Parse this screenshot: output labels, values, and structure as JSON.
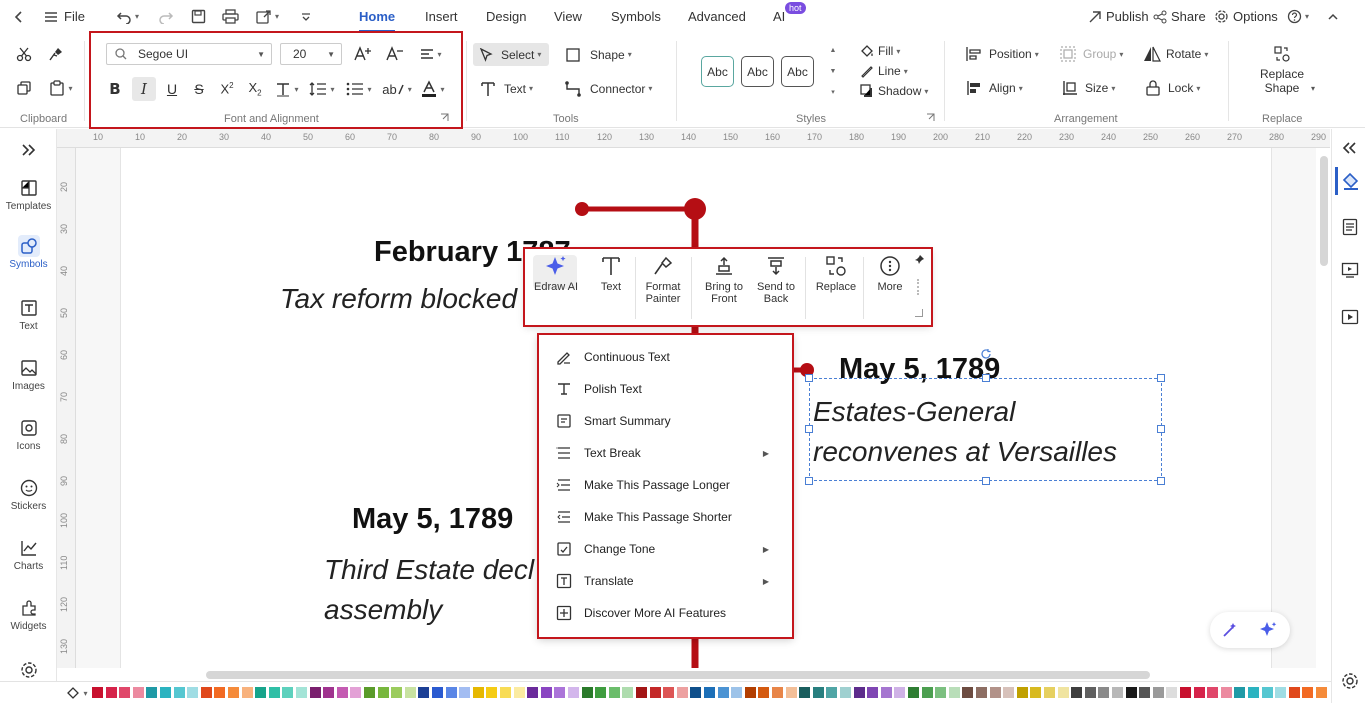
{
  "topbar": {
    "file_label": "File",
    "tabs": [
      {
        "label": "Home"
      },
      {
        "label": "Insert"
      },
      {
        "label": "Design"
      },
      {
        "label": "View"
      },
      {
        "label": "Symbols"
      },
      {
        "label": "Advanced"
      },
      {
        "label": "AI"
      }
    ],
    "hot_badge": "hot",
    "publish_label": "Publish",
    "share_label": "Share",
    "options_label": "Options"
  },
  "ribbon": {
    "groups": {
      "clipboard": "Clipboard",
      "font": "Font and Alignment",
      "tools": "Tools",
      "styles": "Styles",
      "arrangement": "Arrangement",
      "replace": "Replace"
    },
    "font_name": "Segoe UI",
    "font_size": "20",
    "tools": {
      "select": "Select",
      "shape": "Shape",
      "text": "Text",
      "connector": "Connector"
    },
    "style_samples": [
      "Abc",
      "Abc",
      "Abc"
    ],
    "fill": "Fill",
    "line": "Line",
    "shadow": "Shadow",
    "arrangement": {
      "position": "Position",
      "group": "Group",
      "rotate": "Rotate",
      "align": "Align",
      "size": "Size",
      "lock": "Lock"
    },
    "replace_shape": [
      "Replace",
      "Shape"
    ]
  },
  "sidebar": [
    {
      "label": "Templates",
      "icon": "templates-icon"
    },
    {
      "label": "Symbols",
      "icon": "symbols-icon"
    },
    {
      "label": "Text",
      "icon": "text-icon"
    },
    {
      "label": "Images",
      "icon": "images-icon"
    },
    {
      "label": "Icons",
      "icon": "icons-icon"
    },
    {
      "label": "Stickers",
      "icon": "stickers-icon"
    },
    {
      "label": "Charts",
      "icon": "charts-icon"
    },
    {
      "label": "Widgets",
      "icon": "widgets-icon"
    }
  ],
  "ruler": {
    "top": [
      "10",
      "10",
      "20",
      "30",
      "40",
      "50",
      "60",
      "70",
      "80",
      "90",
      "100",
      "110",
      "120",
      "130",
      "140",
      "150",
      "160",
      "170",
      "180",
      "190",
      "200",
      "210",
      "220",
      "230",
      "240",
      "250",
      "260",
      "270",
      "280",
      "290"
    ],
    "left": [
      "20",
      "30",
      "40",
      "50",
      "60",
      "70",
      "80",
      "90",
      "100",
      "110",
      "120",
      "130"
    ]
  },
  "timeline": {
    "events": [
      {
        "date": "February 1787",
        "desc": "Tax reform blocked"
      },
      {
        "date": "May 5, 1789",
        "desc_lines": [
          "Estates-General",
          "reconvenes at Versailles"
        ]
      },
      {
        "date": "May 5, 1789",
        "desc_lines": [
          "Third Estate decl",
          "assembly"
        ]
      }
    ]
  },
  "mini_toolbar": [
    "Edraw AI",
    "Text",
    "Format Painter",
    "Bring to Front",
    "Send to Back",
    "Replace",
    "More"
  ],
  "ai_menu": [
    {
      "label": "Continuous Text",
      "sub": false
    },
    {
      "label": "Polish Text",
      "sub": false
    },
    {
      "label": "Smart Summary",
      "sub": false
    },
    {
      "label": "Text Break",
      "sub": true
    },
    {
      "label": "Make This Passage Longer",
      "sub": false
    },
    {
      "label": "Make This Passage Shorter",
      "sub": false
    },
    {
      "label": "Change Tone",
      "sub": true
    },
    {
      "label": "Translate",
      "sub": true
    },
    {
      "label": "Discover More AI Features",
      "sub": false
    }
  ],
  "colors": {
    "accent": "#2b5fc7",
    "highlight": "#c4161c",
    "timeline": "#b50e14"
  }
}
